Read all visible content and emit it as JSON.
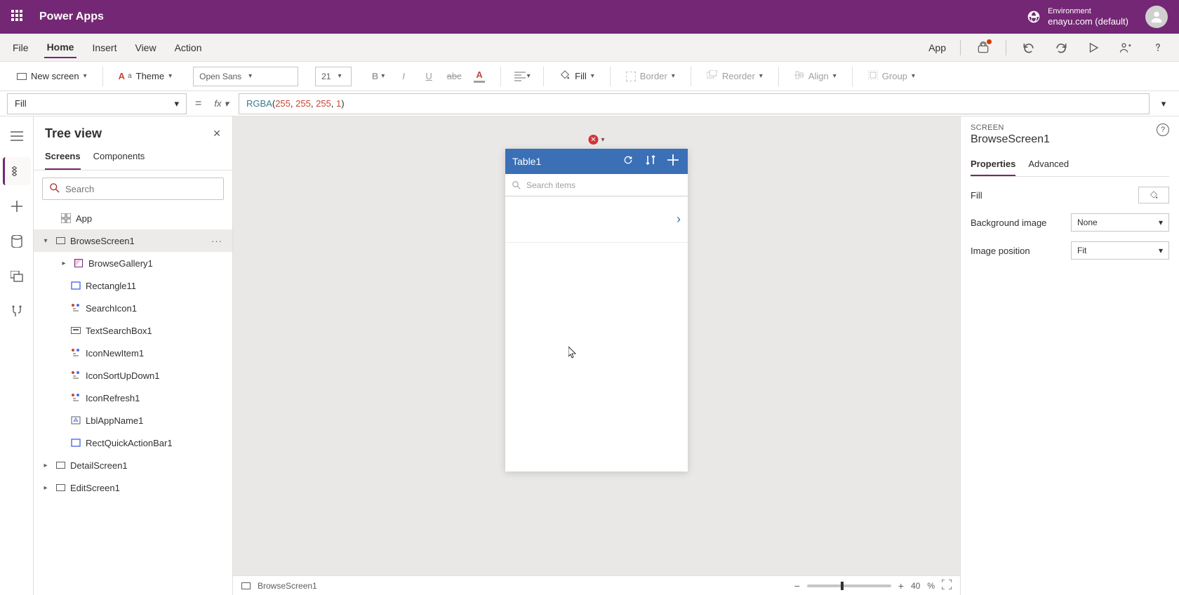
{
  "titlebar": {
    "app_name": "Power Apps",
    "env_label": "Environment",
    "env_value": "enayu.com (default)"
  },
  "menubar": {
    "items": [
      "File",
      "Home",
      "Insert",
      "View",
      "Action"
    ],
    "active": "Home",
    "right_label": "App"
  },
  "ribbon": {
    "new_screen": "New screen",
    "theme": "Theme",
    "font_name": "Open Sans",
    "font_size": "21",
    "fill_label": "Fill",
    "border_label": "Border",
    "reorder_label": "Reorder",
    "align_label": "Align",
    "group_label": "Group"
  },
  "formulabar": {
    "property": "Fill",
    "fx": "fx",
    "formula_fn": "RGBA",
    "formula_args": [
      "255",
      "255",
      "255",
      "1"
    ]
  },
  "treeview": {
    "title": "Tree view",
    "tabs": [
      "Screens",
      "Components"
    ],
    "active_tab": "Screens",
    "search_placeholder": "Search",
    "nodes": {
      "app": "App",
      "browse_screen": "BrowseScreen1",
      "gallery": "BrowseGallery1",
      "children": [
        "Rectangle11",
        "SearchIcon1",
        "TextSearchBox1",
        "IconNewItem1",
        "IconSortUpDown1",
        "IconRefresh1",
        "LblAppName1",
        "RectQuickActionBar1"
      ],
      "detail_screen": "DetailScreen1",
      "edit_screen": "EditScreen1"
    }
  },
  "canvas": {
    "app_title": "Table1",
    "search_placeholder": "Search items"
  },
  "statusbar": {
    "screen_name": "BrowseScreen1",
    "zoom_pct": "40",
    "zoom_unit": "%"
  },
  "properties": {
    "category": "SCREEN",
    "name": "BrowseScreen1",
    "tabs": [
      "Properties",
      "Advanced"
    ],
    "active_tab": "Properties",
    "rows": {
      "fill": "Fill",
      "bg_image": "Background image",
      "bg_image_value": "None",
      "img_pos": "Image position",
      "img_pos_value": "Fit"
    }
  }
}
